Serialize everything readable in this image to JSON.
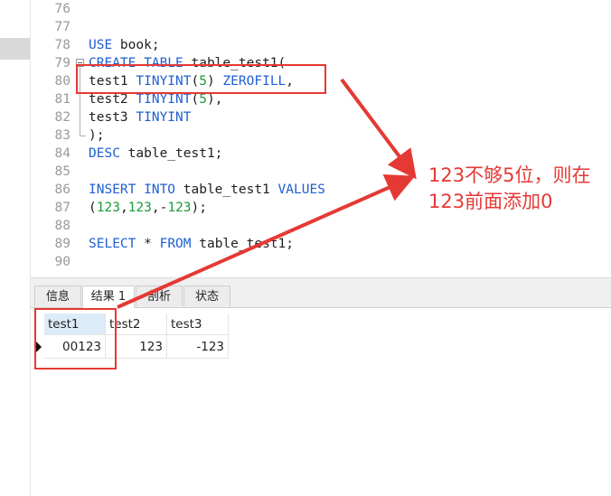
{
  "editor": {
    "lines": [
      {
        "n": "76",
        "parts": []
      },
      {
        "n": "77",
        "parts": []
      },
      {
        "n": "78",
        "parts": [
          [
            "kw",
            "USE"
          ],
          [
            "t",
            " book;"
          ]
        ]
      },
      {
        "n": "79",
        "parts": [
          [
            "kw",
            "CREATE TABLE"
          ],
          [
            "t",
            " table_test1("
          ]
        ]
      },
      {
        "n": "80",
        "parts": [
          [
            "t",
            "test1 "
          ],
          [
            "kw",
            "TINYINT"
          ],
          [
            "t",
            "("
          ],
          [
            "num",
            "5"
          ],
          [
            "t",
            ") "
          ],
          [
            "kw",
            "ZEROFILL"
          ],
          [
            "t",
            ","
          ]
        ]
      },
      {
        "n": "81",
        "parts": [
          [
            "t",
            "test2 "
          ],
          [
            "kw",
            "TINYINT"
          ],
          [
            "t",
            "("
          ],
          [
            "num",
            "5"
          ],
          [
            "t",
            "),"
          ]
        ]
      },
      {
        "n": "82",
        "parts": [
          [
            "t",
            "test3 "
          ],
          [
            "kw",
            "TINYINT"
          ]
        ]
      },
      {
        "n": "83",
        "parts": [
          [
            "t",
            ");"
          ]
        ]
      },
      {
        "n": "84",
        "parts": [
          [
            "kw",
            "DESC"
          ],
          [
            "t",
            " table_test1;"
          ]
        ]
      },
      {
        "n": "85",
        "parts": []
      },
      {
        "n": "86",
        "parts": [
          [
            "kw",
            "INSERT INTO"
          ],
          [
            "t",
            " table_test1 "
          ],
          [
            "kw",
            "VALUES"
          ]
        ]
      },
      {
        "n": "87",
        "parts": [
          [
            "t",
            "("
          ],
          [
            "num",
            "123"
          ],
          [
            "t",
            ","
          ],
          [
            "num",
            "123"
          ],
          [
            "t",
            ",-"
          ],
          [
            "num",
            "123"
          ],
          [
            "t",
            ");"
          ]
        ]
      },
      {
        "n": "88",
        "parts": []
      },
      {
        "n": "89",
        "parts": [
          [
            "kw",
            "SELECT"
          ],
          [
            "t",
            " * "
          ],
          [
            "kw",
            "FROM"
          ],
          [
            "t",
            " table_test1;"
          ]
        ]
      },
      {
        "n": "90",
        "parts": []
      }
    ]
  },
  "tabs": [
    {
      "label": "信息",
      "active": false
    },
    {
      "label": "结果 1",
      "active": true
    },
    {
      "label": "剖析",
      "active": false
    },
    {
      "label": "状态",
      "active": false
    }
  ],
  "results": {
    "columns": [
      "test1",
      "test2",
      "test3"
    ],
    "rows": [
      [
        "00123",
        "123",
        "-123"
      ]
    ]
  },
  "annotation": {
    "line1": "123不够5位，则在",
    "line2": "123前面添加0"
  },
  "colors": {
    "keyword": "#1f5fd1",
    "number": "#1a9a3a",
    "annotation": "#e53935"
  }
}
